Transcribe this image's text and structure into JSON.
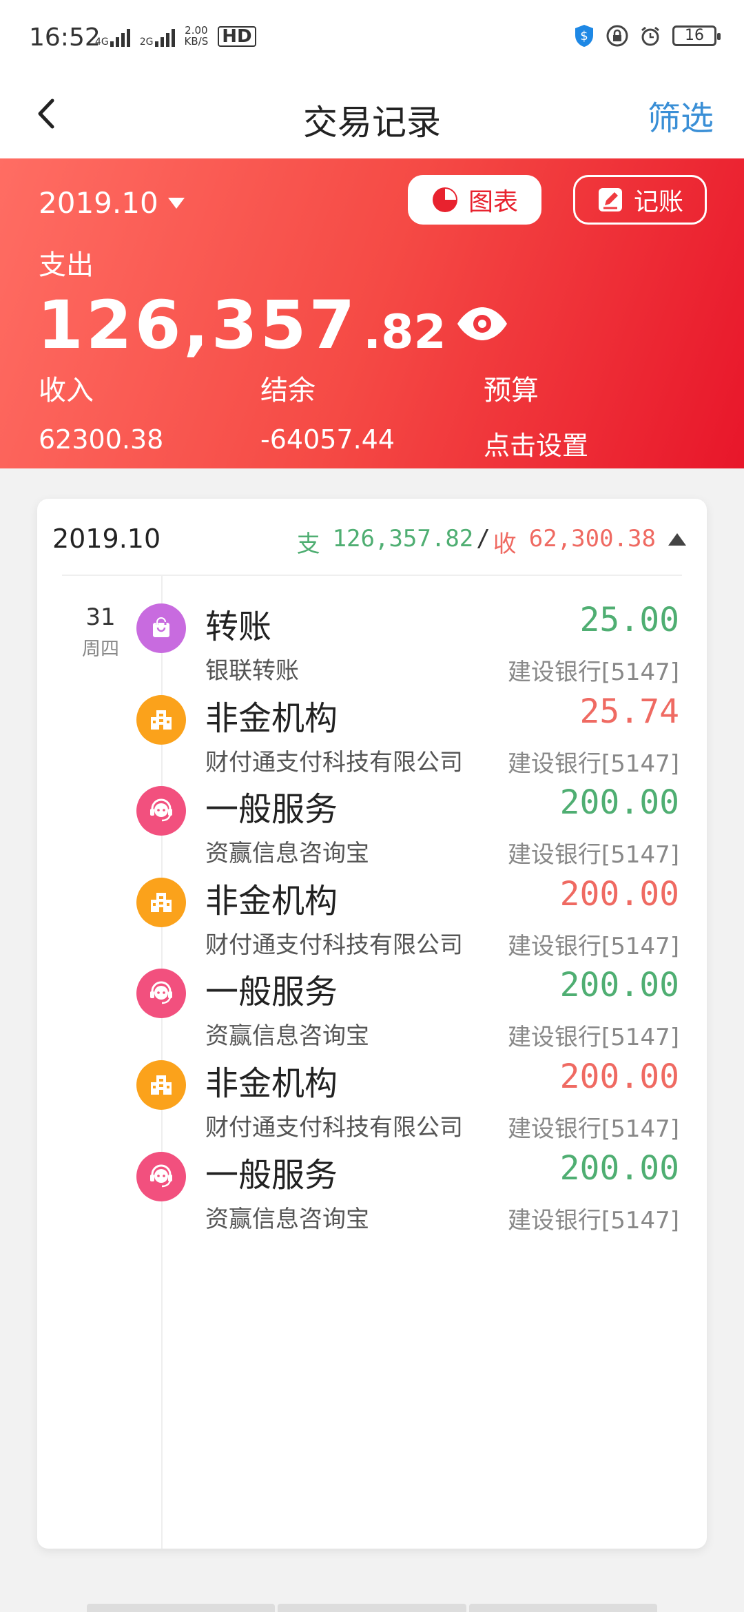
{
  "status_bar": {
    "time": "16:52",
    "net_label_1": "4G",
    "net_label_2": "2G",
    "speed_value": "2.00",
    "speed_unit": "KB/S",
    "hd": "HD",
    "battery": "16"
  },
  "nav": {
    "title": "交易记录",
    "filter": "筛选"
  },
  "summary": {
    "month": "2019.10",
    "chart_button": "图表",
    "book_button": "记账",
    "expense_label": "支出",
    "expense_int": "126,357",
    "expense_dec": ".82",
    "income_label": "收入",
    "income_value": "62300.38",
    "balance_label": "结余",
    "balance_value": "-64057.44",
    "budget_label": "预算",
    "budget_value": "点击设置"
  },
  "month_group": {
    "month": "2019.10",
    "expense_prefix": "支",
    "expense_total": "126,357.82",
    "separator": "/",
    "income_prefix": "收",
    "income_total": "62,300.38"
  },
  "day": {
    "date": "31",
    "weekday": "周四"
  },
  "transactions": [
    {
      "category": "转账",
      "desc": "银联转账",
      "amount": "25.00",
      "bank": "建设银行[5147]",
      "type": "expense",
      "icon": "bag-icon",
      "icon_color": "#c86bdf"
    },
    {
      "category": "非金机构",
      "desc": "财付通支付科技有限公司",
      "amount": "25.74",
      "bank": "建设银行[5147]",
      "type": "income",
      "icon": "building-icon",
      "icon_color": "#fba21b"
    },
    {
      "category": "一般服务",
      "desc": "资赢信息咨询宝",
      "amount": "200.00",
      "bank": "建设银行[5147]",
      "type": "expense",
      "icon": "headset-icon",
      "icon_color": "#f2507e"
    },
    {
      "category": "非金机构",
      "desc": "财付通支付科技有限公司",
      "amount": "200.00",
      "bank": "建设银行[5147]",
      "type": "income",
      "icon": "building-icon",
      "icon_color": "#fba21b"
    },
    {
      "category": "一般服务",
      "desc": "资赢信息咨询宝",
      "amount": "200.00",
      "bank": "建设银行[5147]",
      "type": "expense",
      "icon": "headset-icon",
      "icon_color": "#f2507e"
    },
    {
      "category": "非金机构",
      "desc": "财付通支付科技有限公司",
      "amount": "200.00",
      "bank": "建设银行[5147]",
      "type": "income",
      "icon": "building-icon",
      "icon_color": "#fba21b"
    },
    {
      "category": "一般服务",
      "desc": "资赢信息咨询宝",
      "amount": "200.00",
      "bank": "建设银行[5147]",
      "type": "expense",
      "icon": "headset-icon",
      "icon_color": "#f2507e"
    }
  ],
  "colors": {
    "expense": "#4fae72",
    "income": "#ef6a62",
    "accent": "#e8222e",
    "link": "#3a8fd6"
  }
}
